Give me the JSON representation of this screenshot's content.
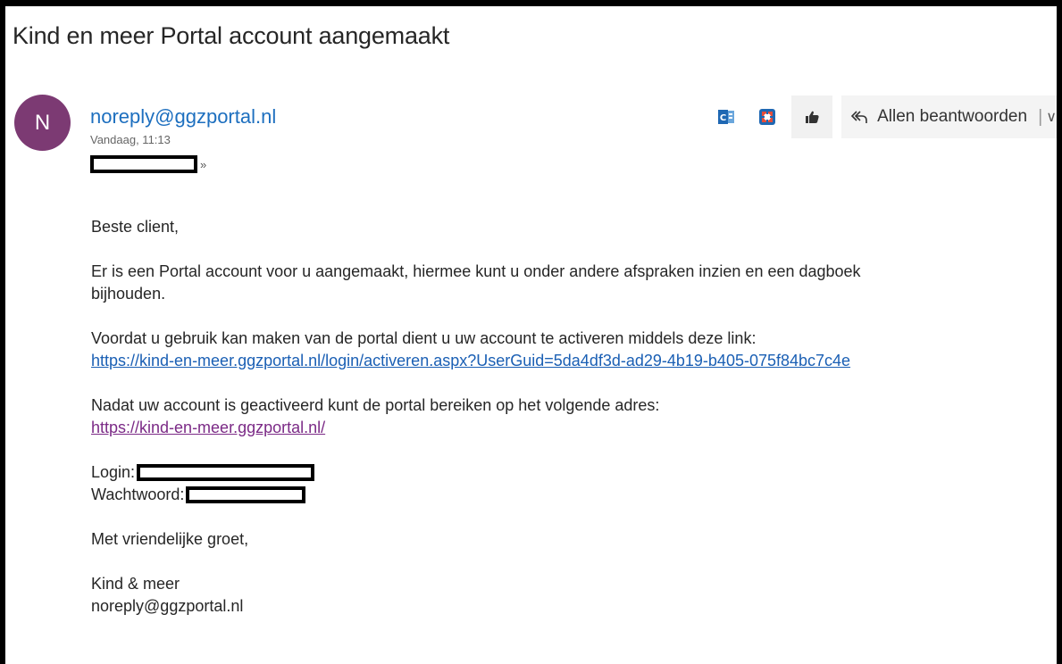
{
  "email": {
    "subject": "Kind en meer Portal account aangemaakt",
    "avatar_initial": "N",
    "avatar_color": "#7c3a73",
    "sender": "noreply@ggzportal.nl",
    "date": "Vandaag, 11:13",
    "recipient_expand_icon": "double-chevron-down-icon"
  },
  "toolbar": {
    "icons": [
      "outlook-add-in-icon",
      "add-in-icon",
      "like-icon",
      "reply-all-icon",
      "chevron-down-icon"
    ],
    "reply_all_label": "Allen beantwoorden",
    "separator": "|"
  },
  "body": {
    "greeting": "Beste client,",
    "para1_line1": "Er is een Portal account voor u aangemaakt, hiermee kunt u onder andere afspraken inzien en een dagboek",
    "para1_line2": "bijhouden.",
    "para2_line1": "Voordat u gebruik kan maken van de portal dient u uw account te activeren middels deze link:",
    "activation_link": "https://kind-en-meer.ggzportal.nl/login/activeren.aspx?UserGuid=5da4df3d-ad29-4b19-b405-075f84bc7c4e",
    "para3_line1": "Nadat uw account is geactiveerd kunt de portal bereiken op het volgende adres:",
    "portal_link": "https://kind-en-meer.ggzportal.nl/",
    "login_label": "Login:",
    "password_label": "Wachtwoord:",
    "closing": "Met vriendelijke groet,",
    "signature_name": "Kind & meer",
    "signature_email": "noreply@ggzportal.nl"
  },
  "colors": {
    "link": "#1a5fb4",
    "visited_link": "#7b2a86",
    "sender": "#1d6fbf"
  }
}
